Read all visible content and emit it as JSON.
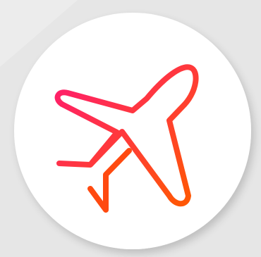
{
  "icon": {
    "name": "airplane-icon",
    "gradient_start": "#ff1a72",
    "gradient_end": "#ff5a00"
  },
  "colors": {
    "background": "#ececec",
    "background_panel": "#e6e6e6",
    "circle": "#ffffff"
  }
}
